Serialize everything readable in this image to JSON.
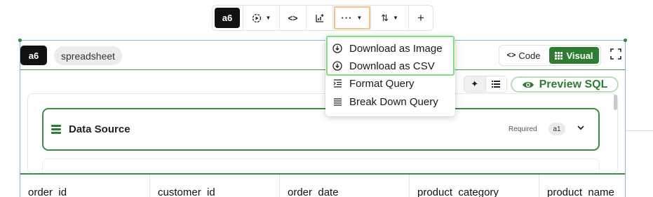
{
  "toolbar": {
    "cell_id": "a6",
    "run_icon": "play-circle-icon",
    "code_icon": "code-icon",
    "chart_add_icon": "chart-add-icon",
    "more_icon": "more-horizontal-icon",
    "sort_icon": "sort-icon",
    "add_label": "+"
  },
  "cell": {
    "id": "a6",
    "type_label": "spreadsheet",
    "view_toggle": {
      "code_label": "Code",
      "visual_label": "Visual",
      "selected": "Visual"
    },
    "expand_icon": "expand-icon"
  },
  "query_builder": {
    "ai_icon": "sparkle-icon",
    "list_icon": "list-icon",
    "preview_label": "Preview SQL",
    "data_source": {
      "title": "Data Source",
      "required_label": "Required",
      "badge": "a1"
    }
  },
  "table": {
    "columns": [
      "order_id",
      "customer_id",
      "order_date",
      "product_category",
      "product_name"
    ]
  },
  "more_menu": {
    "items": [
      {
        "label": "Download as Image",
        "icon": "download-icon"
      },
      {
        "label": "Download as CSV",
        "icon": "download-icon"
      },
      {
        "label": "Format Query",
        "icon": "format-indent-icon"
      },
      {
        "label": "Break Down Query",
        "icon": "break-down-icon"
      }
    ]
  },
  "colors": {
    "accent_green": "#2f7d32",
    "frame_blue": "#8fb3e6",
    "highlight_orange": "#f5c587",
    "highlight_green": "#7fe07f"
  }
}
